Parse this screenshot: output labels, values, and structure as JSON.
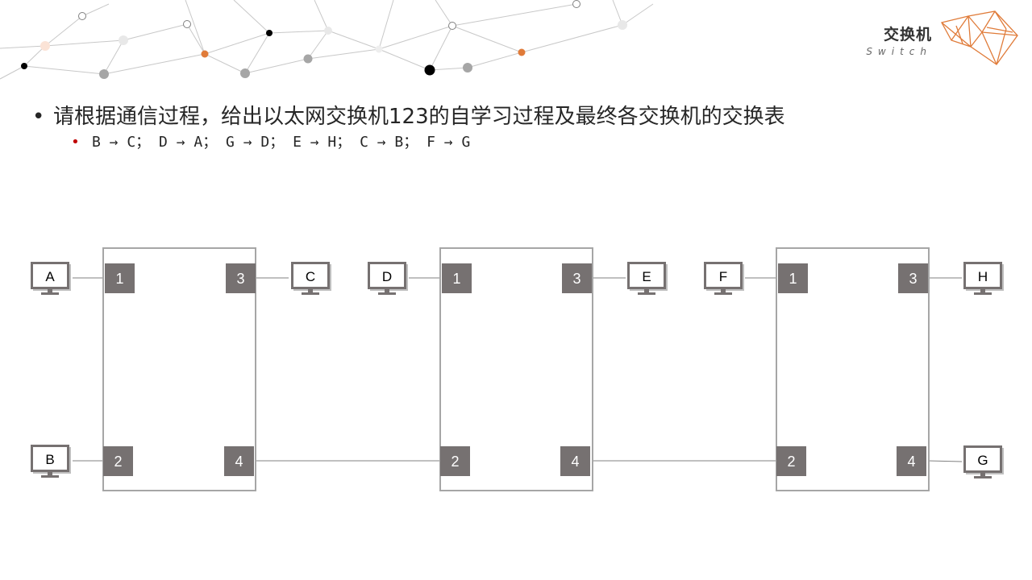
{
  "brand": {
    "title": "交换机",
    "subtitle": "Switch"
  },
  "content": {
    "question": "请根据通信过程，给出以太网交换机123的自学习过程及最终各交换机的交换表",
    "sequence": "B → C；  D → A；  G → D；  E → H；  C → B；  F → G"
  },
  "switches": [
    {
      "id": "S1",
      "ports": [
        "1",
        "2",
        "3",
        "4"
      ]
    },
    {
      "id": "S2",
      "ports": [
        "1",
        "2",
        "3",
        "4"
      ]
    },
    {
      "id": "S3",
      "ports": [
        "1",
        "2",
        "3",
        "4"
      ]
    }
  ],
  "hosts": [
    "A",
    "B",
    "C",
    "D",
    "E",
    "F",
    "H",
    "G"
  ],
  "colors": {
    "port_fill": "#767171",
    "box_stroke": "#a6a6a6",
    "accent": "#e07b39"
  }
}
